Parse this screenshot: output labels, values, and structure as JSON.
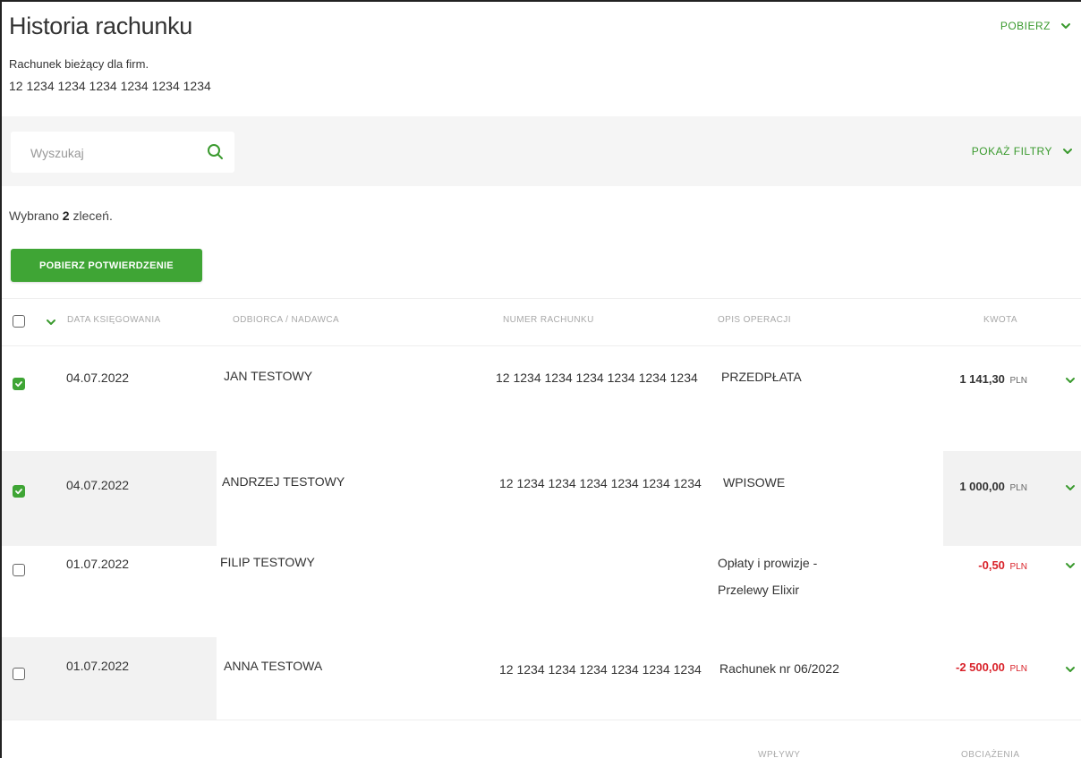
{
  "header": {
    "title": "Historia rachunku",
    "download_label": "POBIERZ",
    "account_type": "Rachunek bieżący dla firm.",
    "account_number": "12 1234 1234 1234 1234 1234 1234"
  },
  "search": {
    "placeholder": "Wyszukaj",
    "filters_label": "POKAŻ FILTRY"
  },
  "selection": {
    "prefix": "Wybrano",
    "count": "2",
    "suffix": "zleceń.",
    "confirm_button": "POBIERZ POTWIERDZENIE"
  },
  "table": {
    "columns": {
      "date": "DATA KSIĘGOWANIA",
      "party": "ODBIORCA / NADAWCA",
      "account": "NUMER RACHUNKU",
      "description": "OPIS OPERACJI",
      "amount": "KWOTA"
    },
    "rows": [
      {
        "checked": true,
        "date": "04.07.2022",
        "party": "JAN TESTOWY",
        "account": "12 1234 1234 1234 1234 1234 1234",
        "description": "PRZEDPŁATA",
        "amount": "1 141,30",
        "currency": "PLN",
        "negative": false
      },
      {
        "checked": true,
        "date": "04.07.2022",
        "party": "ANDRZEJ TESTOWY",
        "account": "12 1234 1234 1234 1234 1234 1234",
        "description": "WPISOWE",
        "amount": "1 000,00",
        "currency": "PLN",
        "negative": false
      },
      {
        "checked": false,
        "date": "01.07.2022",
        "party": "FILIP TESTOWY",
        "account": "",
        "description": "Opłaty i prowizje - Przelewy Elixir",
        "amount": "-0,50",
        "currency": "PLN",
        "negative": true
      },
      {
        "checked": false,
        "date": "01.07.2022",
        "party": "ANNA TESTOWA",
        "account": "12 1234 1234 1234 1234 1234 1234",
        "description": "Rachunek nr 06/2022",
        "amount": "-2 500,00",
        "currency": "PLN",
        "negative": true
      }
    ]
  },
  "footer": {
    "inflows_label": "WPŁYWY",
    "debits_label": "OBCIĄŻENIA"
  },
  "colors": {
    "accent": "#3fa535",
    "negative": "#d9222a"
  }
}
